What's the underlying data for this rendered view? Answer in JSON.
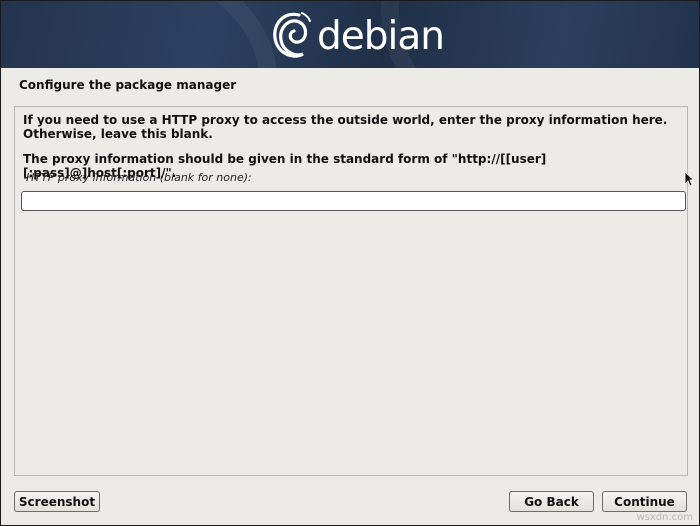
{
  "banner": {
    "logo_text": "debian",
    "logo_icon": "debian-swirl-icon"
  },
  "page": {
    "title": "Configure the package manager"
  },
  "main": {
    "paragraph1": "If you need to use a HTTP proxy to access the outside world, enter the proxy information here.\nOtherwise, leave this blank.",
    "paragraph2": "The proxy information should be given in the standard form of \"http://[[user][:pass]@]host[:port]/\".",
    "field_label": "HTTP proxy information (blank for none):",
    "field_value": ""
  },
  "buttons": {
    "screenshot": "Screenshot",
    "go_back": "Go Back",
    "continue": "Continue"
  },
  "watermark": "wsxdn.com",
  "colors": {
    "banner": "#2c4160",
    "background": "#ecebe8",
    "text": "#111111"
  }
}
